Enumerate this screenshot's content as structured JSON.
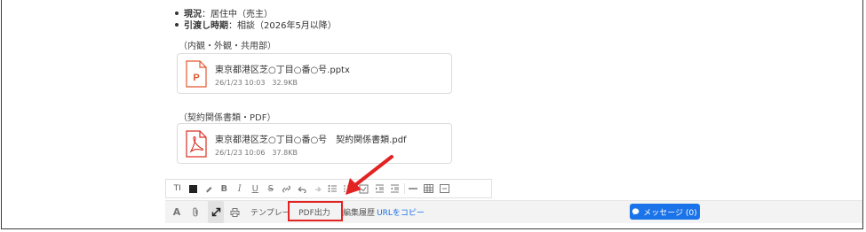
{
  "status": {
    "current_label": "現況",
    "current_value": "：居住中（売主）",
    "handover_label": "引渡し時期",
    "handover_value": "：相談（2026年5月以降）"
  },
  "sections": [
    {
      "title": "（内観・外観・共用部）",
      "file": {
        "icon": "pptx-file-icon",
        "name": "東京都港区芝○丁目○番○号.pptx",
        "meta": "26/1/23 10:03　32.9KB"
      }
    },
    {
      "title": "（契約関係書類・PDF）",
      "file": {
        "icon": "pdf-file-icon",
        "name": "東京都港区芝○丁目○番○号　契約関係書類.pdf",
        "meta": "26/1/23 10:06　37.8KB"
      }
    }
  ],
  "format_toolbar": {
    "text_size_label": "TI",
    "bold": "B",
    "italic": "I",
    "underline": "U",
    "strike": "S"
  },
  "bottom_toolbar": {
    "font_label": "A",
    "template_label": "テンプレー",
    "pdf_label": "PDF出力",
    "history_label": "編集履歴",
    "copy_url_label": "URLをコピー",
    "message_label": "メッセージ (0)"
  },
  "colors": {
    "accent": "#1a73e8",
    "highlight": "#e32222",
    "pptx_icon": "#e4572e",
    "pdf_icon": "#d93025"
  }
}
